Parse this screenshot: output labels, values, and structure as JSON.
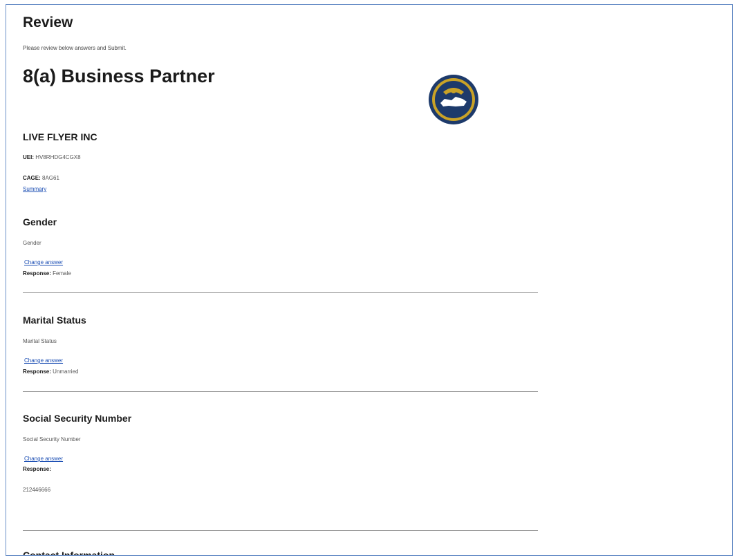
{
  "page": {
    "title": "Review",
    "subtitle": "Please review below answers and Submit.",
    "program_title": "8(a) Business Partner"
  },
  "business": {
    "name": "LIVE FLYER INC",
    "uei_label": "UEI:",
    "uei_value": "HV8RHDG4CGX8",
    "cage_label": "CAGE:",
    "cage_value": "8AG61",
    "summary_link": "Summary"
  },
  "sections": [
    {
      "title": "Gender",
      "question": "Gender",
      "change_label": "Change answer",
      "response_label": "Response:",
      "response_value": "Female"
    },
    {
      "title": "Marital Status",
      "question": "Marital Status",
      "change_label": "Change answer",
      "response_label": "Response:",
      "response_value": "Unmarried"
    },
    {
      "title": "Social Security Number",
      "question": "Social Security Number",
      "change_label": "Change answer",
      "response_label": "Response:",
      "response_value": "212446666"
    },
    {
      "title": "Contact Information"
    }
  ],
  "colors": {
    "link": "#1a4db3",
    "seal_outer": "#1d3a6b",
    "seal_gold": "#c9a227"
  },
  "icons": {
    "seal": "sba-seal-icon"
  }
}
